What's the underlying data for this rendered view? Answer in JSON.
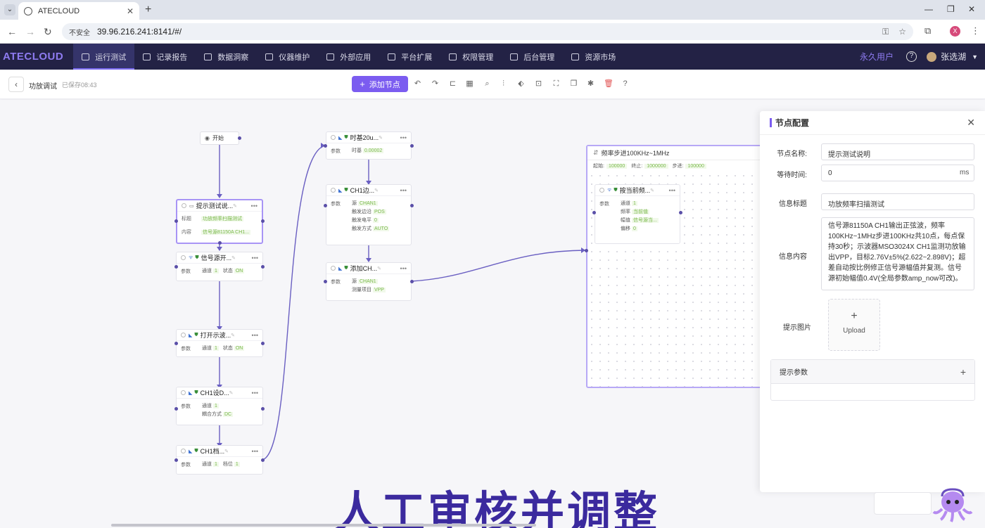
{
  "browser": {
    "tab_title": "ATECLOUD",
    "security_label": "不安全",
    "url": "39.96.216.241:8141/#/",
    "profile_initial": "X"
  },
  "nav": {
    "brand": "ATECLOUD",
    "items": [
      {
        "label": "运行测试",
        "active": true
      },
      {
        "label": "记录报告"
      },
      {
        "label": "数据洞察"
      },
      {
        "label": "仪器维护"
      },
      {
        "label": "外部应用"
      },
      {
        "label": "平台扩展"
      },
      {
        "label": "权限管理"
      },
      {
        "label": "后台管理"
      },
      {
        "label": "资源市场"
      }
    ],
    "license": "永久用户",
    "help": "?",
    "user": "张选湖"
  },
  "toolbar": {
    "flow_name": "功放调试",
    "saved": "已保存08:43",
    "add_node": "添加节点"
  },
  "nodes": {
    "start": "开始",
    "prompt": {
      "title": "提示测试说...",
      "row1_label": "标题",
      "row1_value": "功放频率扫描测试",
      "row2_label": "内容",
      "row2_value": "信号源81150A CH1..."
    },
    "siggen_on": {
      "title": "信号源开...",
      "label": "参数",
      "k1": "通道",
      "v1": "1",
      "k2": "状态",
      "v2": "ON"
    },
    "scope_on": {
      "title": "打开示波...",
      "label": "参数",
      "k1": "通道",
      "v1": "1",
      "k2": "状态",
      "v2": "ON"
    },
    "ch1_set": {
      "title": "CH1设D...",
      "label": "参数",
      "k1": "通道",
      "v1": "1",
      "k2": "耦合方式",
      "v2": "DC"
    },
    "ch1_gear": {
      "title": "CH1档...",
      "label": "参数",
      "k1": "通道",
      "v1": "1",
      "k2": "档位",
      "v2": "1"
    },
    "timebase": {
      "title": "时基20u...",
      "label": "参数",
      "k1": "时基",
      "v1": "0.00002"
    },
    "ch1_edge": {
      "title": "CH1边...",
      "label": "参数",
      "k1": "源",
      "v1": "CHAN1",
      "k2": "触发边沿",
      "v2": "POS",
      "k3": "触发电平",
      "v3": "0",
      "k4": "触发方式",
      "v4": "AUTO"
    },
    "add_ch": {
      "title": "添加CH...",
      "label": "参数",
      "k1": "源",
      "v1": "CHAN1",
      "k2": "测量项目",
      "v2": "VPP"
    },
    "loop": {
      "title": "频率步进100KHz~1MHz",
      "k1": "起始:",
      "v1": "100000",
      "k2": "终止:",
      "v2": "1000000",
      "k3": "步进:",
      "v3": "100000"
    },
    "current_freq": {
      "title": "按当前频...",
      "label": "参数",
      "k1": "通道",
      "v1": "1",
      "k2": "频率",
      "v2": "当前值",
      "k3": "幅值",
      "v3": "信号源当...",
      "k4": "偏移",
      "v4": "0"
    }
  },
  "panel": {
    "title": "节点配置",
    "name_label": "节点名称:",
    "name_value": "提示测试说明",
    "wait_label": "等待时间:",
    "wait_value": "0",
    "wait_unit": "ms",
    "msg_title_label": "信息标题",
    "msg_title_value": "功放频率扫描测试",
    "msg_content_label": "信息内容",
    "msg_content_value": "信号源81150A CH1输出正弦波，频率100KHz~1MHz步进100KHz共10点，每点保持30秒；示波器MSO3024X CH1监测功放输出VPP，目标2.76V±5%(2.622~2.898V)；超差自动按比例修正信号源幅值并复测。信号源初始幅值0.4V(全局参数amp_now可改)。",
    "image_label": "提示图片",
    "upload_label": "Upload",
    "params_label": "提示参数"
  },
  "caption": "人工审核并调整",
  "colors": {
    "accent": "#7b5cf0",
    "nav_bg": "#232245",
    "edge": "#5a4fa8",
    "caption": "#3b2a9e"
  }
}
